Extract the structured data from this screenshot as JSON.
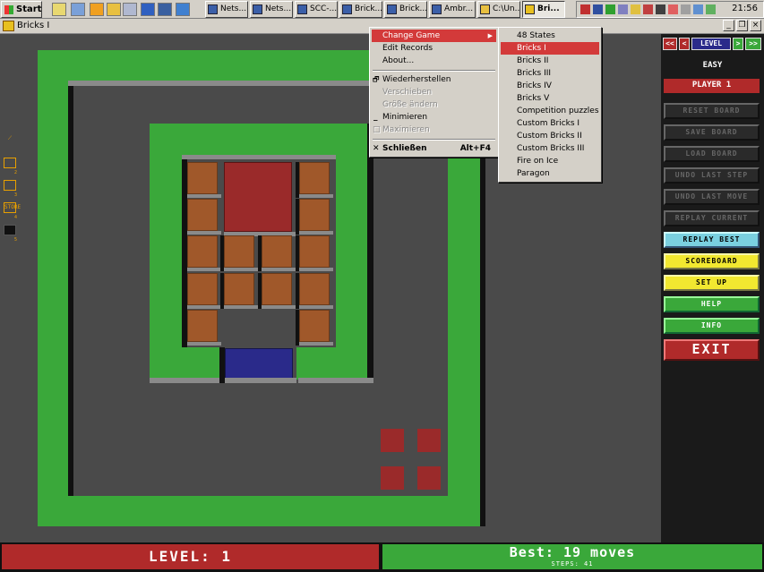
{
  "taskbar": {
    "start_label": "Start",
    "tasks": [
      {
        "label": "Nets..."
      },
      {
        "label": "Nets..."
      },
      {
        "label": "SCC-..."
      },
      {
        "label": "Brick..."
      },
      {
        "label": "Brick..."
      },
      {
        "label": "Ambr..."
      },
      {
        "label": "C:\\Un..."
      },
      {
        "label": "Bri..."
      }
    ],
    "clock": "21:56"
  },
  "window": {
    "title": "Bricks I",
    "minimize": "_",
    "restore": "❐",
    "close": "×"
  },
  "toolbox": {
    "tool_labels": [
      "",
      "",
      "",
      "STORE",
      ""
    ],
    "tool_numbers": [
      "1",
      "2",
      "3",
      "4",
      "5"
    ]
  },
  "panel": {
    "nav_first": "<<",
    "nav_prev": "<",
    "nav_level": "LEVEL",
    "nav_next": ">",
    "nav_last": ">>",
    "mode": "EASY",
    "player": "PLAYER 1",
    "buttons": {
      "reset_board": "RESET BOARD",
      "save_board": "SAVE BOARD",
      "load_board": "LOAD BOARD",
      "undo_last_step": "UNDO LAST STEP",
      "undo_last_move": "UNDO LAST MOVE",
      "replay_current": "REPLAY CURRENT",
      "replay_best": "REPLAY BEST",
      "scoreboard": "SCOREBOARD",
      "set_up": "SET UP",
      "help": "HELP",
      "info": "INFO",
      "exit": "EXIT"
    }
  },
  "status": {
    "level": "LEVEL: 1",
    "best": "Best: 19 moves",
    "steps": "STEPS: 41"
  },
  "menu": {
    "change_game": "Change Game",
    "edit_records": "Edit Records",
    "about": "About...",
    "restore": "Wiederherstellen",
    "move": "Verschieben",
    "size": "Größe ändern",
    "minimize": "Minimieren",
    "maximize": "Maximieren",
    "close": "Schließen",
    "close_shortcut": "Alt+F4"
  },
  "submenu": {
    "items": [
      "48 States",
      "Bricks I",
      "Bricks II",
      "Bricks III",
      "Bricks IV",
      "Bricks V",
      "Competition puzzles",
      "Custom Bricks I",
      "Custom Bricks II",
      "Custom Bricks III",
      "Fire on Ice",
      "Paragon"
    ],
    "selected_index": 1
  },
  "colors": {
    "wall": "#3aa83a",
    "brick": "#a0582a",
    "big_block": "#9a2a2a",
    "player_block": "#2a2a8a",
    "menu_highlight": "#d33a3a"
  }
}
